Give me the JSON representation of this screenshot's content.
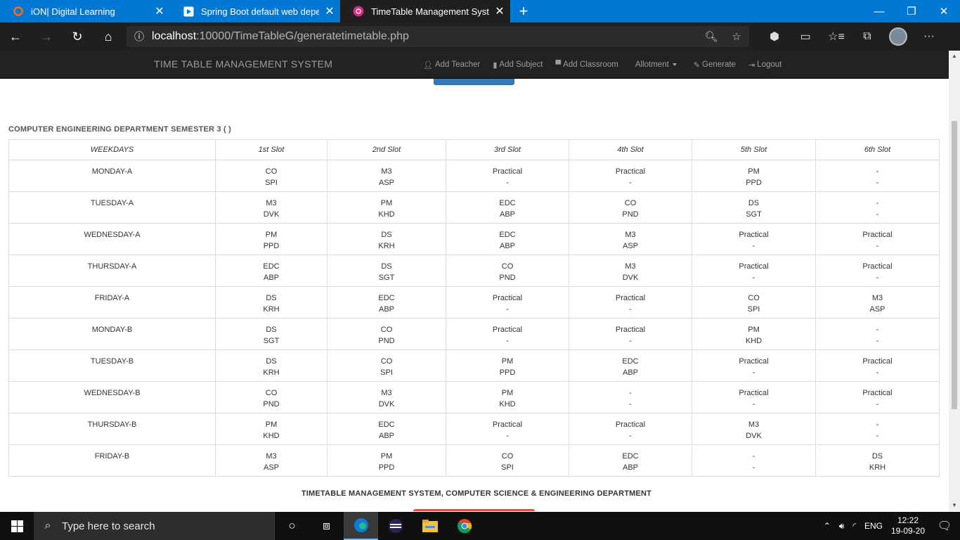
{
  "browser": {
    "tabs": [
      {
        "title": "iON| Digital Learning",
        "icon": "ion-icon"
      },
      {
        "title": "Spring Boot default web depend",
        "icon": "video-icon"
      },
      {
        "title": "TimeTable Management System",
        "icon": "app-icon"
      }
    ],
    "url_host": "localhost",
    "url_path": ":10000/TimeTableG/generatetimetable.php"
  },
  "navbar": {
    "brand": "TIME TABLE MANAGEMENT SYSTEM",
    "items": [
      "Add Teacher",
      "Add Subject",
      "Add Classroom",
      "Allotment",
      "Generate",
      "Logout"
    ]
  },
  "dept_title": "COMPUTER ENGINEERING DEPARTMENT SEMESTER 3 ( )",
  "table": {
    "headers": [
      "WEEKDAYS",
      "1st Slot",
      "2nd Slot",
      "3rd Slot",
      "4th Slot",
      "5th Slot",
      "6th Slot"
    ],
    "rows": [
      {
        "day": "MONDAY-A",
        "slots": [
          [
            "CO",
            "SPI"
          ],
          [
            "M3",
            "ASP"
          ],
          [
            "Practical",
            "-"
          ],
          [
            "Practical",
            "-"
          ],
          [
            "PM",
            "PPD"
          ],
          [
            "-",
            "-"
          ]
        ]
      },
      {
        "day": "TUESDAY-A",
        "slots": [
          [
            "M3",
            "DVK"
          ],
          [
            "PM",
            "KHD"
          ],
          [
            "EDC",
            "ABP"
          ],
          [
            "CO",
            "PND"
          ],
          [
            "DS",
            "SGT"
          ],
          [
            "-",
            "-"
          ]
        ]
      },
      {
        "day": "WEDNESDAY-A",
        "slots": [
          [
            "PM",
            "PPD"
          ],
          [
            "DS",
            "KRH"
          ],
          [
            "EDC",
            "ABP"
          ],
          [
            "M3",
            "ASP"
          ],
          [
            "Practical",
            "-"
          ],
          [
            "Practical",
            "-"
          ]
        ]
      },
      {
        "day": "THURSDAY-A",
        "slots": [
          [
            "EDC",
            "ABP"
          ],
          [
            "DS",
            "SGT"
          ],
          [
            "CO",
            "PND"
          ],
          [
            "M3",
            "DVK"
          ],
          [
            "Practical",
            "-"
          ],
          [
            "Practical",
            "-"
          ]
        ]
      },
      {
        "day": "FRIDAY-A",
        "slots": [
          [
            "DS",
            "KRH"
          ],
          [
            "EDC",
            "ABP"
          ],
          [
            "Practical",
            "-"
          ],
          [
            "Practical",
            "-"
          ],
          [
            "CO",
            "SPI"
          ],
          [
            "M3",
            "ASP"
          ]
        ]
      },
      {
        "day": "MONDAY-B",
        "slots": [
          [
            "DS",
            "SGT"
          ],
          [
            "CO",
            "PND"
          ],
          [
            "Practical",
            "-"
          ],
          [
            "Practical",
            "-"
          ],
          [
            "PM",
            "KHD"
          ],
          [
            "-",
            "-"
          ]
        ]
      },
      {
        "day": "TUESDAY-B",
        "slots": [
          [
            "DS",
            "KRH"
          ],
          [
            "CO",
            "SPI"
          ],
          [
            "PM",
            "PPD"
          ],
          [
            "EDC",
            "ABP"
          ],
          [
            "Practical",
            "-"
          ],
          [
            "Practical",
            "-"
          ]
        ]
      },
      {
        "day": "WEDNESDAY-B",
        "slots": [
          [
            "CO",
            "PND"
          ],
          [
            "M3",
            "DVK"
          ],
          [
            "PM",
            "KHD"
          ],
          [
            "-",
            "-"
          ],
          [
            "Practical",
            "-"
          ],
          [
            "Practical",
            "-"
          ]
        ]
      },
      {
        "day": "THURSDAY-B",
        "slots": [
          [
            "PM",
            "KHD"
          ],
          [
            "EDC",
            "ABP"
          ],
          [
            "Practical",
            "-"
          ],
          [
            "Practical",
            "-"
          ],
          [
            "M3",
            "DVK"
          ],
          [
            "-",
            "-"
          ]
        ]
      },
      {
        "day": "FRIDAY-B",
        "slots": [
          [
            "M3",
            "ASP"
          ],
          [
            "PM",
            "PPD"
          ],
          [
            "CO",
            "SPI"
          ],
          [
            "EDC",
            "ABP"
          ],
          [
            "-",
            "-"
          ],
          [
            "DS",
            "KRH"
          ]
        ]
      }
    ]
  },
  "footer": "TIMETABLE MANAGEMENT SYSTEM, COMPUTER SCIENCE & ENGINEERING DEPARTMENT",
  "taskbar": {
    "search_placeholder": "Type here to search",
    "language": "ENG",
    "time": "12:22",
    "date": "19-09-20"
  }
}
